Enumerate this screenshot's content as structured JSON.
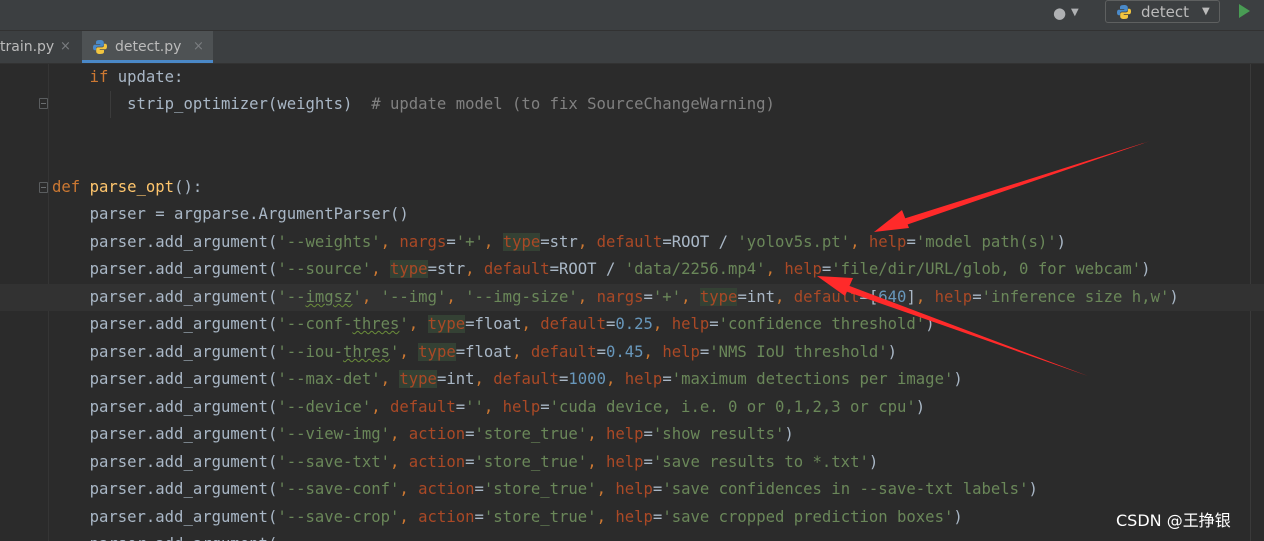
{
  "toolbar": {
    "user_icon": "user-icon",
    "run_config": {
      "label": "detect",
      "icon": "python-icon"
    },
    "run_icon": "run-triangle-icon"
  },
  "tabs": [
    {
      "label": "train.py",
      "active": false,
      "close": "×"
    },
    {
      "label": "detect.py",
      "active": true,
      "close": "×"
    }
  ],
  "colors": {
    "keyword": "#cc7832",
    "function": "#ffc66d",
    "identifier": "#a9b7c6",
    "string": "#6a8759",
    "number": "#6897bb",
    "comment": "#808080",
    "parameter": "#aa4926",
    "arrow": "#ff3333",
    "tab_accent": "#4a88c7"
  },
  "code": {
    "l1": {
      "kw": "if",
      "rest": " update:"
    },
    "l2": {
      "call": "strip_optimizer(weights)",
      "comment": "# update model (to fix SourceChangeWarning)"
    },
    "l5": {
      "kw": "def",
      "fn": "parse_opt",
      "rest": "():"
    },
    "l6": {
      "text": "parser = argparse.ArgumentParser()"
    },
    "call": "parser.add_argument(",
    "l7": {
      "s1": "'--weights'",
      "p1": "nargs",
      "s2": "'+'",
      "p2": "type",
      "v2": "str",
      "p3": "default",
      "v3": "ROOT / ",
      "s3": "'yolov5s.pt'",
      "p4": "help",
      "s4": "'model path(s)'"
    },
    "l8": {
      "s1": "'--source'",
      "p1": "type",
      "v1": "str",
      "p2": "default",
      "v2": "ROOT / ",
      "s2": "'data/2256.mp4'",
      "p3": "help",
      "s3": "'file/dir/URL/glob, 0 for webcam'"
    },
    "l9": {
      "s1a": "'--",
      "s1b": "imgsz",
      "s1c": "'",
      "s2": "'--img'",
      "s3": "'--img-size'",
      "p1": "nargs",
      "s4": "'+'",
      "p2": "type",
      "v2": "int",
      "p3": "default",
      "v3": "[",
      "n3": "640",
      "v3b": "]",
      "p4": "help",
      "s5": "'inference size h,w'"
    },
    "l10": {
      "s1a": "'--conf-",
      "s1b": "thres",
      "s1c": "'",
      "p1": "type",
      "v1": "float",
      "p2": "default",
      "n2": "0.25",
      "p3": "help",
      "s3": "'confidence threshold'"
    },
    "l11": {
      "s1a": "'--iou-",
      "s1b": "thres",
      "s1c": "'",
      "p1": "type",
      "v1": "float",
      "p2": "default",
      "n2": "0.45",
      "p3": "help",
      "s3": "'NMS IoU threshold'"
    },
    "l12": {
      "s1": "'--max-det'",
      "p1": "type",
      "v1": "int",
      "p2": "default",
      "n2": "1000",
      "p3": "help",
      "s3": "'maximum detections per image'"
    },
    "l13": {
      "s1": "'--device'",
      "p1": "default",
      "s2": "''",
      "p2": "help",
      "s3": "'cuda device, i.e. 0 or 0,1,2,3 or cpu'"
    },
    "l14": {
      "s1": "'--view-img'",
      "p1": "action",
      "s2": "'store_true'",
      "p2": "help",
      "s3": "'show results'"
    },
    "l15": {
      "s1": "'--save-txt'",
      "p1": "action",
      "s2": "'store_true'",
      "p2": "help",
      "s3": "'save results to *.txt'"
    },
    "l16": {
      "s1": "'--save-conf'",
      "p1": "action",
      "s2": "'store_true'",
      "p2": "help",
      "s3": "'save confidences in --save-txt labels'"
    },
    "l17": {
      "s1": "'--save-crop'",
      "p1": "action",
      "s2": "'store_true'",
      "p2": "help",
      "s3": "'save cropped prediction boxes'"
    }
  },
  "watermark": "CSDN @王挣银"
}
